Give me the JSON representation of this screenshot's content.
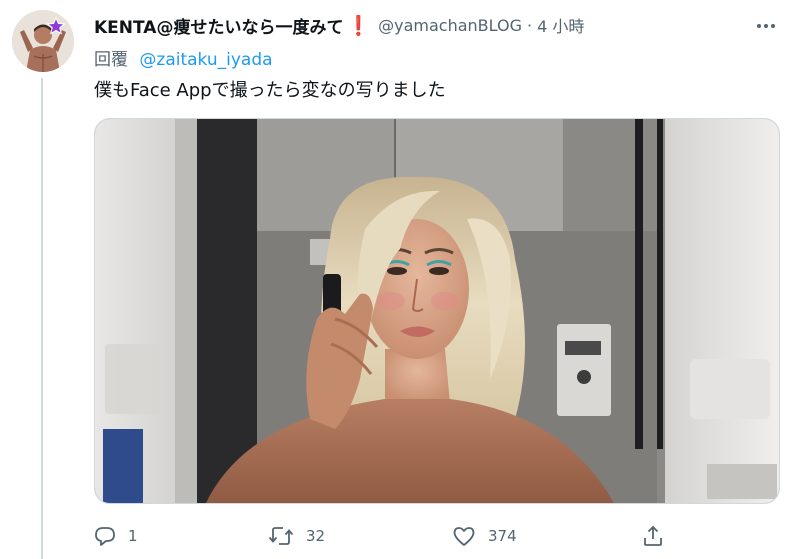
{
  "tweet": {
    "display_name": "KENTA@痩せたいなら一度みて",
    "alert_mark": "❗",
    "handle": "@yamachanBLOG",
    "separator": "·",
    "timestamp": "4 小時",
    "reply_prefix": "回覆",
    "reply_to": "@zaitaku_iyada",
    "text": "僕もFace Appで撮ったら変なの写りました"
  },
  "actions": {
    "reply_count": "1",
    "retweet_count": "32",
    "like_count": "374"
  },
  "icons": {
    "more": "more-horizontal-icon",
    "reply": "reply-icon",
    "retweet": "retweet-icon",
    "like": "heart-icon",
    "share": "share-icon"
  },
  "colors": {
    "link": "#1d9bf0",
    "secondary_text": "#536471",
    "alert": "#dd2e44",
    "thread_line": "#cfd9de"
  }
}
